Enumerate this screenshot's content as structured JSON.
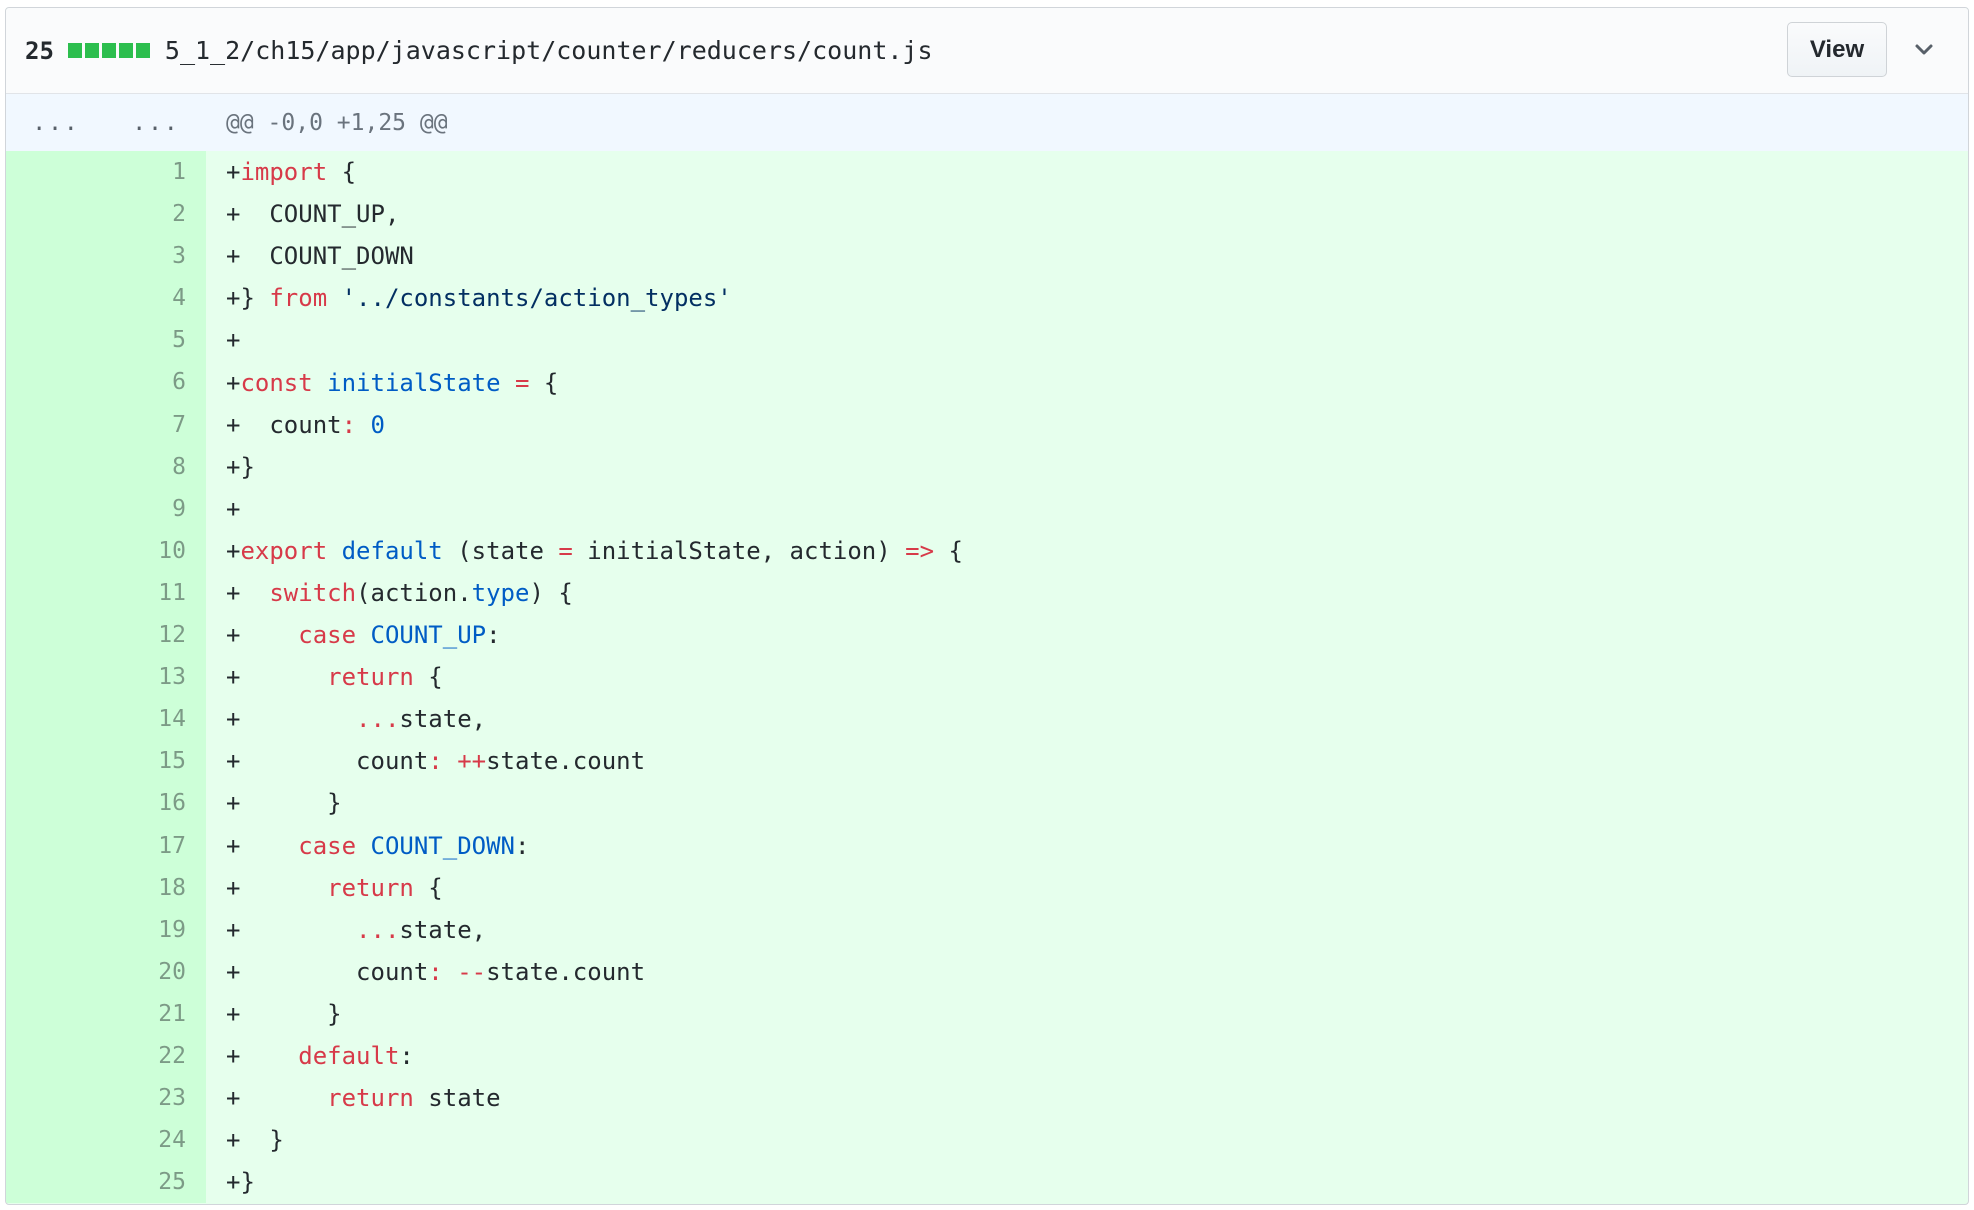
{
  "header": {
    "change_count": "25",
    "diffstat_colors": [
      "#2cbe4e",
      "#2cbe4e",
      "#2cbe4e",
      "#2cbe4e",
      "#2cbe4e"
    ],
    "file_path": "5_1_2/ch15/app/javascript/counter/reducers/count.js",
    "view_button": "View",
    "expand_icon": "chevron-down-icon"
  },
  "hunk": {
    "old_marker": "...",
    "new_marker": "...",
    "text": "@@ -0,0 +1,25 @@"
  },
  "colors": {
    "keyword": "#d73a49",
    "constant": "#005cc5",
    "string": "#032f62",
    "addition_bg": "#e6ffed",
    "addition_num_bg": "#cdffd8",
    "hunk_bg": "#f1f8ff"
  },
  "lines": [
    {
      "num": "1",
      "tokens": [
        [
          "+",
          ""
        ],
        [
          "import",
          "k"
        ],
        [
          " {",
          ""
        ]
      ]
    },
    {
      "num": "2",
      "tokens": [
        [
          "+  COUNT_UP,",
          ""
        ]
      ]
    },
    {
      "num": "3",
      "tokens": [
        [
          "+  COUNT_DOWN",
          ""
        ]
      ]
    },
    {
      "num": "4",
      "tokens": [
        [
          "+} ",
          ""
        ],
        [
          "from",
          "k"
        ],
        [
          " ",
          ""
        ],
        [
          "'../constants/action_types'",
          "s"
        ]
      ]
    },
    {
      "num": "5",
      "tokens": [
        [
          "+",
          ""
        ]
      ]
    },
    {
      "num": "6",
      "tokens": [
        [
          "+",
          ""
        ],
        [
          "const",
          "k"
        ],
        [
          " ",
          ""
        ],
        [
          "initialState",
          "c"
        ],
        [
          " ",
          ""
        ],
        [
          "=",
          "k"
        ],
        [
          " {",
          ""
        ]
      ]
    },
    {
      "num": "7",
      "tokens": [
        [
          "+  count",
          ""
        ],
        [
          ":",
          "k"
        ],
        [
          " ",
          ""
        ],
        [
          "0",
          "c"
        ]
      ]
    },
    {
      "num": "8",
      "tokens": [
        [
          "+}",
          ""
        ]
      ]
    },
    {
      "num": "9",
      "tokens": [
        [
          "+",
          ""
        ]
      ]
    },
    {
      "num": "10",
      "tokens": [
        [
          "+",
          ""
        ],
        [
          "export",
          "k"
        ],
        [
          " ",
          ""
        ],
        [
          "default",
          "c"
        ],
        [
          " (state ",
          ""
        ],
        [
          "=",
          "k"
        ],
        [
          " initialState, action) ",
          ""
        ],
        [
          "=>",
          "k"
        ],
        [
          " {",
          ""
        ]
      ]
    },
    {
      "num": "11",
      "tokens": [
        [
          "+  ",
          ""
        ],
        [
          "switch",
          "k"
        ],
        [
          "(action.",
          ""
        ],
        [
          "type",
          "c"
        ],
        [
          ") {",
          ""
        ]
      ]
    },
    {
      "num": "12",
      "tokens": [
        [
          "+    ",
          ""
        ],
        [
          "case",
          "k"
        ],
        [
          " ",
          ""
        ],
        [
          "COUNT_UP",
          "c"
        ],
        [
          ":",
          ""
        ]
      ]
    },
    {
      "num": "13",
      "tokens": [
        [
          "+      ",
          ""
        ],
        [
          "return",
          "k"
        ],
        [
          " {",
          ""
        ]
      ]
    },
    {
      "num": "14",
      "tokens": [
        [
          "+        ",
          ""
        ],
        [
          "...",
          "k"
        ],
        [
          "state,",
          ""
        ]
      ]
    },
    {
      "num": "15",
      "tokens": [
        [
          "+        count",
          ""
        ],
        [
          ":",
          "k"
        ],
        [
          " ",
          ""
        ],
        [
          "++",
          "k"
        ],
        [
          "state.count",
          ""
        ]
      ]
    },
    {
      "num": "16",
      "tokens": [
        [
          "+      }",
          ""
        ]
      ]
    },
    {
      "num": "17",
      "tokens": [
        [
          "+    ",
          ""
        ],
        [
          "case",
          "k"
        ],
        [
          " ",
          ""
        ],
        [
          "COUNT_DOWN",
          "c"
        ],
        [
          ":",
          ""
        ]
      ]
    },
    {
      "num": "18",
      "tokens": [
        [
          "+      ",
          ""
        ],
        [
          "return",
          "k"
        ],
        [
          " {",
          ""
        ]
      ]
    },
    {
      "num": "19",
      "tokens": [
        [
          "+        ",
          ""
        ],
        [
          "...",
          "k"
        ],
        [
          "state,",
          ""
        ]
      ]
    },
    {
      "num": "20",
      "tokens": [
        [
          "+        count",
          ""
        ],
        [
          ":",
          "k"
        ],
        [
          " ",
          ""
        ],
        [
          "--",
          "k"
        ],
        [
          "state.count",
          ""
        ]
      ]
    },
    {
      "num": "21",
      "tokens": [
        [
          "+      }",
          ""
        ]
      ]
    },
    {
      "num": "22",
      "tokens": [
        [
          "+    ",
          ""
        ],
        [
          "default",
          "k"
        ],
        [
          ":",
          ""
        ]
      ]
    },
    {
      "num": "23",
      "tokens": [
        [
          "+      ",
          ""
        ],
        [
          "return",
          "k"
        ],
        [
          " state",
          ""
        ]
      ]
    },
    {
      "num": "24",
      "tokens": [
        [
          "+  }",
          ""
        ]
      ]
    },
    {
      "num": "25",
      "tokens": [
        [
          "+}",
          ""
        ]
      ]
    }
  ]
}
